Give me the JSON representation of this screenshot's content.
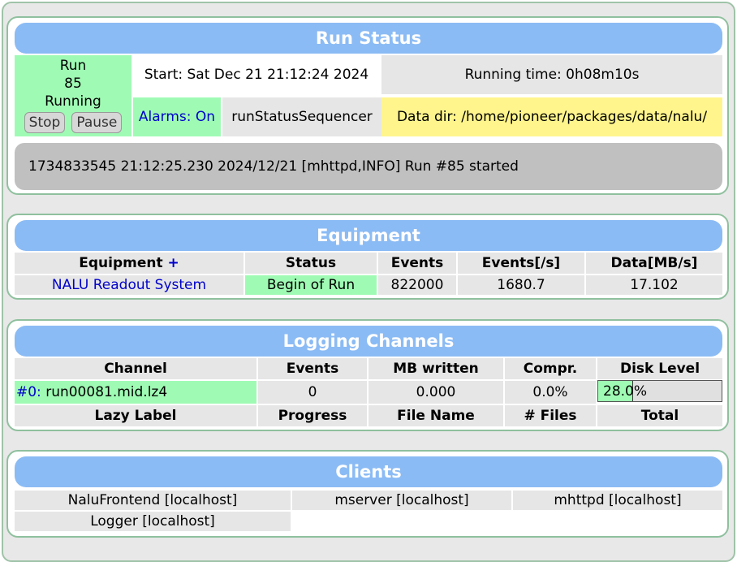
{
  "run_status": {
    "title": "Run Status",
    "run_label": "Run",
    "run_number": "85",
    "state": "Running",
    "stop_label": "Stop",
    "pause_label": "Pause",
    "start": "Start: Sat Dec 21 21:12:24 2024",
    "running_time": "Running time: 0h08m10s",
    "alarms": "Alarms: On",
    "sequencer": "runStatusSequencer",
    "data_dir": "Data dir: /home/pioneer/packages/data/nalu/",
    "message": "1734833545 21:12:25.230 2024/12/21 [mhttpd,INFO] Run #85 started"
  },
  "equipment": {
    "title": "Equipment",
    "headers": {
      "equipment": "Equipment",
      "add": "+",
      "status": "Status",
      "events": "Events",
      "rate": "Events[/s]",
      "data": "Data[MB/s]"
    },
    "rows": [
      {
        "name": "NALU Readout System",
        "status": "Begin of Run",
        "events": "822000",
        "rate": "1680.7",
        "data": "17.102"
      }
    ]
  },
  "logging": {
    "title": "Logging Channels",
    "headers": {
      "channel": "Channel",
      "events": "Events",
      "mb_written": "MB written",
      "compr": "Compr.",
      "disk_level": "Disk Level"
    },
    "channels": [
      {
        "id": "#0:",
        "file": "run00081.mid.lz4",
        "events": "0",
        "mb_written": "0.000",
        "compr": "0.0%",
        "disk_level_text": "28.0%",
        "disk_level_fraction": 0.28
      }
    ],
    "lazy_headers": {
      "label": "Lazy Label",
      "progress": "Progress",
      "file_name": "File Name",
      "files": "# Files",
      "total": "Total"
    }
  },
  "clients": {
    "title": "Clients",
    "items": [
      "NaluFrontend [localhost]",
      "mserver [localhost]",
      "mhttpd [localhost]",
      "Logger [localhost]"
    ]
  },
  "colors": {
    "header_blue": "#8bbbf4",
    "running_green": "#9ffbb4",
    "data_dir_yellow": "#fff58c",
    "message_grey": "#c0c0c0",
    "link_blue": "#0000cc"
  }
}
